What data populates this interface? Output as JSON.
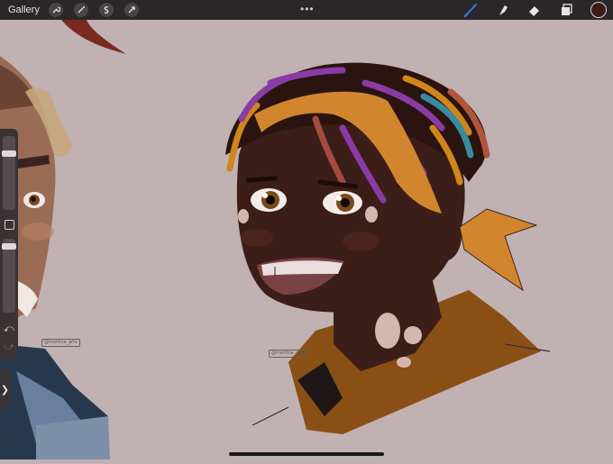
{
  "toolbar": {
    "gallery_label": "Gallery",
    "left_tools": [
      "wrench-icon",
      "magic-wand-icon",
      "selection-icon",
      "transform-icon"
    ],
    "more_dots": "•••",
    "right_tools": [
      "brush-icon",
      "smudge-icon",
      "eraser-icon",
      "layers-icon"
    ],
    "current_color": "#3d1a17",
    "accent_color": "#2f7de1"
  },
  "sidebar": {
    "undo_label": "⤺",
    "redo_label": "⤻"
  },
  "canvas": {
    "background_color": "#c1b1b3",
    "signature_left": "@mortina_arts",
    "signature_right": "@mortina_arts"
  },
  "expand_tab": {
    "label": "❯"
  }
}
